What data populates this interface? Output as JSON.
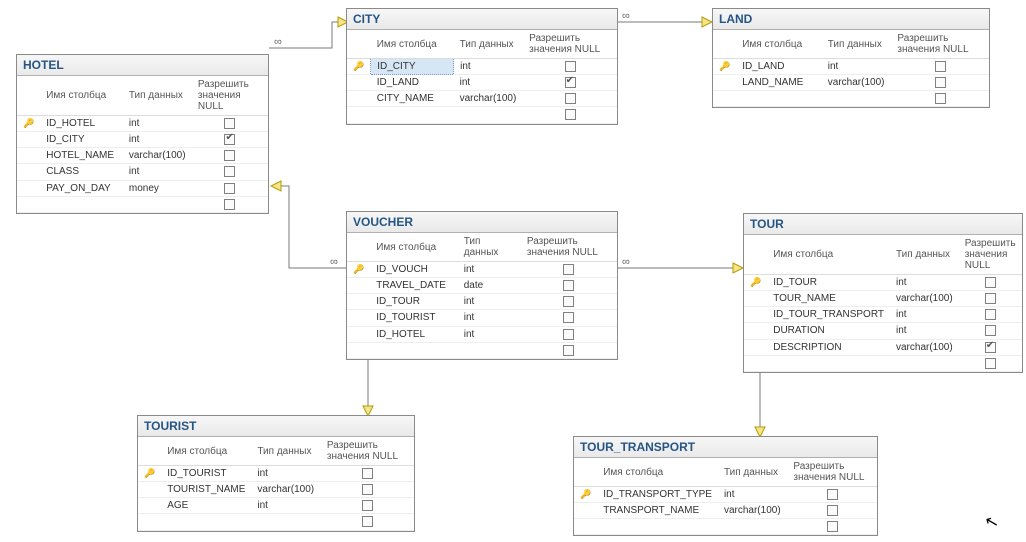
{
  "headers": {
    "col_name": "Имя столбца",
    "col_type": "Тип данных",
    "col_null": "Разрешить значения NULL"
  },
  "tables": {
    "hotel": {
      "title": "HOTEL",
      "cols": [
        {
          "key": true,
          "name": "ID_HOTEL",
          "type": "int",
          "null": false
        },
        {
          "key": false,
          "name": "ID_CITY",
          "type": "int",
          "null": true
        },
        {
          "key": false,
          "name": "HOTEL_NAME",
          "type": "varchar(100)",
          "null": false
        },
        {
          "key": false,
          "name": "CLASS",
          "type": "int",
          "null": false
        },
        {
          "key": false,
          "name": "PAY_ON_DAY",
          "type": "money",
          "null": false
        }
      ]
    },
    "city": {
      "title": "CITY",
      "cols": [
        {
          "key": true,
          "name": "ID_CITY",
          "type": "int",
          "null": false,
          "selected": true
        },
        {
          "key": false,
          "name": "ID_LAND",
          "type": "int",
          "null": true
        },
        {
          "key": false,
          "name": "CITY_NAME",
          "type": "varchar(100)",
          "null": false
        }
      ]
    },
    "land": {
      "title": "LAND",
      "cols": [
        {
          "key": true,
          "name": "ID_LAND",
          "type": "int",
          "null": false
        },
        {
          "key": false,
          "name": "LAND_NAME",
          "type": "varchar(100)",
          "null": false
        }
      ]
    },
    "voucher": {
      "title": "VOUCHER",
      "cols": [
        {
          "key": true,
          "name": "ID_VOUCH",
          "type": "int",
          "null": false
        },
        {
          "key": false,
          "name": "TRAVEL_DATE",
          "type": "date",
          "null": false
        },
        {
          "key": false,
          "name": "ID_TOUR",
          "type": "int",
          "null": false
        },
        {
          "key": false,
          "name": "ID_TOURIST",
          "type": "int",
          "null": false
        },
        {
          "key": false,
          "name": "ID_HOTEL",
          "type": "int",
          "null": false
        }
      ]
    },
    "tour": {
      "title": "TOUR",
      "cols": [
        {
          "key": true,
          "name": "ID_TOUR",
          "type": "int",
          "null": false
        },
        {
          "key": false,
          "name": "TOUR_NAME",
          "type": "varchar(100)",
          "null": false
        },
        {
          "key": false,
          "name": "ID_TOUR_TRANSPORT",
          "type": "int",
          "null": false
        },
        {
          "key": false,
          "name": "DURATION",
          "type": "int",
          "null": false
        },
        {
          "key": false,
          "name": "DESCRIPTION",
          "type": "varchar(100)",
          "null": true
        }
      ]
    },
    "tourist": {
      "title": "TOURIST",
      "cols": [
        {
          "key": true,
          "name": "ID_TOURIST",
          "type": "int",
          "null": false
        },
        {
          "key": false,
          "name": "TOURIST_NAME",
          "type": "varchar(100)",
          "null": false
        },
        {
          "key": false,
          "name": "AGE",
          "type": "int",
          "null": false
        }
      ]
    },
    "tour_transport": {
      "title": "TOUR_TRANSPORT",
      "cols": [
        {
          "key": true,
          "name": "ID_TRANSPORT_TYPE",
          "type": "int",
          "null": false
        },
        {
          "key": false,
          "name": "TRANSPORT_NAME",
          "type": "varchar(100)",
          "null": false
        }
      ]
    }
  },
  "relationships": [
    {
      "from": "hotel",
      "to": "city"
    },
    {
      "from": "city",
      "to": "land"
    },
    {
      "from": "voucher",
      "to": "hotel"
    },
    {
      "from": "voucher",
      "to": "tourist"
    },
    {
      "from": "voucher",
      "to": "tour"
    },
    {
      "from": "tour",
      "to": "tour_transport"
    }
  ]
}
